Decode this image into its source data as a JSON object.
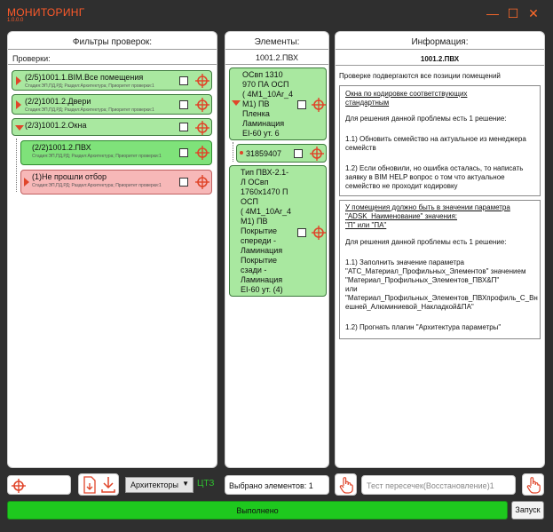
{
  "window": {
    "title": "МОНИТОРИНГ",
    "subtitle": "1.0.0.0",
    "accent": "#ff5a2a"
  },
  "filters": {
    "title": "Фильтры проверок:",
    "checks_label": "Проверки:",
    "items": [
      {
        "title": "(2/5)1001.1.BIM.Все помещения",
        "meta": "Стадия:ЭП,ПД,РД; Раздел:Архитектура; Приоритет проверки:1"
      },
      {
        "title": "(2/2)1001.2.Двери",
        "meta": "Стадия:ЭП,ПД,РД; Раздел:Архитектура; Приоритет проверки:1"
      },
      {
        "title": "(2/3)1001.2.Окна"
      },
      {
        "title": "(2/2)1001.2.ПВХ",
        "meta": "Стадия:ЭП,ПД,РД; Раздел:Архитектура; Приоритет проверки:1"
      },
      {
        "title": "(1)Не прошли отбор",
        "meta": "Стадия:ЭП,ПД,РД; Раздел:Архитектура; Приоритет проверки:1"
      }
    ]
  },
  "elements": {
    "title": "Элементы:",
    "subtitle": "1001.2.ПВХ",
    "items": [
      {
        "lines": [
          "ОСвп 1310",
          "970 ПА ОСП",
          "( 4М1_10Ar_4",
          "М1) ПВ",
          "Пленка",
          "Ламинация",
          "EI-60 ут. 6"
        ]
      },
      {
        "lines": [
          "31859407"
        ]
      },
      {
        "lines": [
          "Тип ПВХ-2.1-",
          "Л ОСвп",
          "1760x1470 П",
          "ОСП",
          "( 4М1_10Ar_4",
          "М1) ПВ",
          "Покрытие",
          "спереди -",
          "Ламинация",
          "Покрытие",
          "сзади -",
          "Ламинация",
          "EI-60 ут. (4)"
        ]
      }
    ]
  },
  "info": {
    "title": "Информация:",
    "check_name": "1001.2.ПВХ",
    "note": "Проверке подвергаются все позиции помещений",
    "box1": {
      "head1": "Окна по кодировке соответствующих",
      "head2": "стандартным",
      "p1": "Для решения данной проблемы есть 1 решение:",
      "p2a": "1.1) Обновить семейство на актуальное из менеджера",
      "p2b": "семейств",
      "p3a": "1.2) Если обновили, но ошибка осталась, то написать",
      "p3b": "заявку в BIM HELP вопрос о том что актуальное",
      "p3c": "семейство не проходит кодировку"
    },
    "box2": {
      "head1": "У помещения должно быть в значении параметра",
      "head2": "\"ADSK_Наименование\" значения:",
      "head3": "\"П\" или \"ПА\"",
      "p1": "Для решения данной проблемы есть 1 решение:",
      "p2a": "1.1) Заполнить значение параметра",
      "p2b": "\"АТС_Материал_Профильных_Элементов\" значением",
      "p2c": "\"Материал_Профильных_Элементов_ПВХ&П\"",
      "p2d": "или",
      "p2e": "\"Материал_Профильных_Элементов_ПВХпрофиль_С_Вн",
      "p2f": "ешней_Алюминиевой_Накладкой&ПА\"",
      "p3": "1.2) Прогнать плагин \"Архитектура параметры\""
    }
  },
  "bottom": {
    "discipline": "Архитекторы",
    "ctz": "ЦТЗ",
    "selected": "Выбрано элементов: 1",
    "intersect_placeholder": "Тест пересечек(Восстановление)1",
    "status": "Выполнено",
    "start": "Запуск"
  }
}
